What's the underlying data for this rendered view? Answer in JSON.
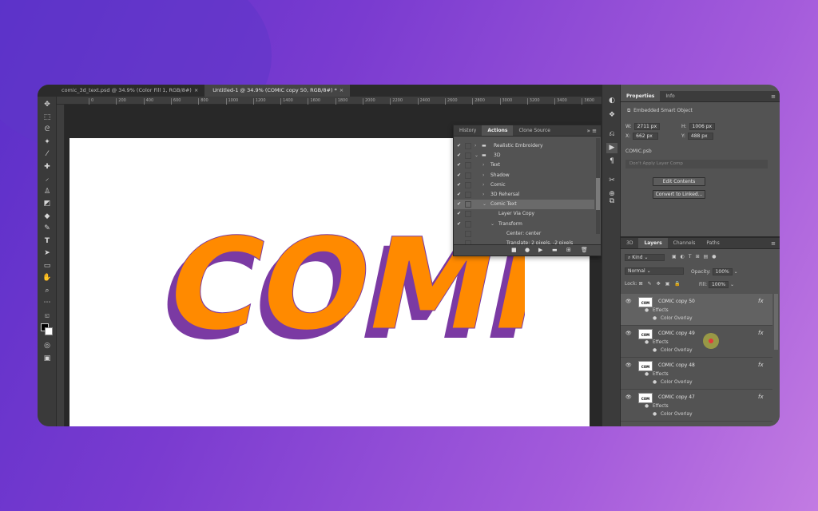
{
  "tabs": [
    {
      "label": "comic_3d_text.psd @ 34.9% (Color Fill 1, RGB/8#)",
      "close": "×"
    },
    {
      "label": "Untitled-1 @ 34.9% (COMIC copy 50, RGB/8#) *",
      "close": "×"
    }
  ],
  "ruler": [
    "0",
    "200",
    "400",
    "600",
    "800",
    "1000",
    "1200",
    "1400",
    "1600",
    "1800",
    "2000",
    "2200",
    "2400",
    "2600",
    "2800",
    "3000",
    "3200",
    "3400",
    "3600",
    "3800"
  ],
  "canvas": {
    "word": "COMIC",
    "fill": "#ff8a00",
    "shadow": "#7b3aa3"
  },
  "actions_panel": {
    "tabs": [
      "History",
      "Actions",
      "Clone Source"
    ],
    "active_tab": "Actions",
    "items": [
      {
        "label": "Realistic Embroidery",
        "checked": true,
        "twisty": "›",
        "folder": true,
        "level": 0
      },
      {
        "label": "3D",
        "checked": true,
        "twisty": "⌄",
        "folder": true,
        "level": 0
      },
      {
        "label": "Text",
        "checked": true,
        "twisty": "›",
        "level": 1
      },
      {
        "label": "Shadow",
        "checked": true,
        "twisty": "›",
        "level": 1
      },
      {
        "label": "Comic",
        "checked": true,
        "twisty": "›",
        "level": 1
      },
      {
        "label": "3D Rehersal",
        "checked": true,
        "twisty": "›",
        "level": 1
      },
      {
        "label": "Comic Text",
        "checked": true,
        "twisty": "⌄",
        "level": 1,
        "selected": true
      },
      {
        "label": "Layer Via Copy",
        "checked": true,
        "twisty": "",
        "level": 2
      },
      {
        "label": "Transform",
        "checked": true,
        "twisty": "⌄",
        "level": 2
      },
      {
        "label": "Center: center",
        "checked": false,
        "twisty": "",
        "level": 3
      },
      {
        "label": "Translate: 2 pixels, -2 pixels",
        "checked": false,
        "twisty": "",
        "level": 3
      }
    ]
  },
  "properties": {
    "tabs": [
      "Properties",
      "Info"
    ],
    "type": "Embedded Smart Object",
    "w_label": "W:",
    "w": "2711 px",
    "h_label": "H:",
    "h": "1006 px",
    "x_label": "X:",
    "x": "662 px",
    "y_label": "Y:",
    "y": "488 px",
    "file": "COMIC.psb",
    "layer_comp": "Don't Apply Layer Comp",
    "edit_button": "Edit Contents",
    "convert_button": "Convert to Linked..."
  },
  "layers_panel": {
    "tabs": [
      "3D",
      "Layers",
      "Channels",
      "Paths"
    ],
    "active_tab": "Layers",
    "kind": "Kind",
    "blend": "Normal",
    "opacity_label": "Opacity:",
    "opacity": "100%",
    "lock_label": "Lock:",
    "fill_label": "Fill:",
    "fill": "100%",
    "layers": [
      {
        "name": "COMIC copy 50",
        "selected": true
      },
      {
        "name": "COMIC copy 49",
        "selected": false
      },
      {
        "name": "COMIC copy 48",
        "selected": false
      },
      {
        "name": "COMIC copy 47",
        "selected": false
      }
    ],
    "effects_label": "Effects",
    "color_overlay_label": "Color Overlay",
    "fx": "fx",
    "thumb_text": "COM"
  }
}
